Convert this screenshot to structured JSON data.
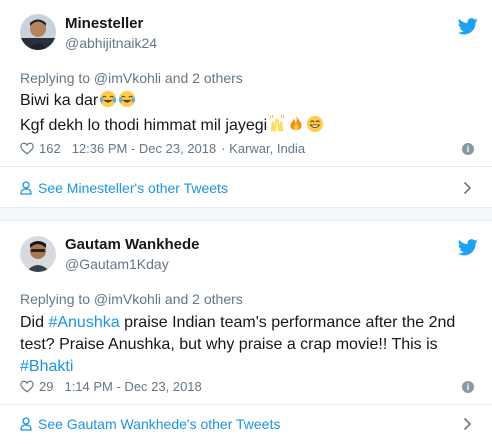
{
  "tweets": [
    {
      "name": "Minesteller",
      "handle": "@abhijitnaik24",
      "replying": "Replying to @imVkohli and 2 others",
      "line1": "Biwi ka dar",
      "line2": "Kgf dekh lo thodi himmat mil jayegi",
      "likes": "162",
      "time": "12:36 PM - Dec 23, 2018",
      "location": "· Karwar, India",
      "other_tweets": "See Minesteller's other Tweets"
    },
    {
      "name": "Gautam Wankhede",
      "handle": "@Gautam1Kday",
      "replying": "Replying to @imVkohli and 2 others",
      "text_a": "Did ",
      "hashtag1": "#Anushka",
      "text_b": " praise Indian team's performance after the 2nd test? Praise Anushka, but why praise a crap movie!! This is ",
      "hashtag2": "#Bhakti",
      "likes": "29",
      "time": "1:14 PM - Dec 23, 2018",
      "other_tweets": "See Gautam Wankhede's other Tweets"
    }
  ],
  "colors": {
    "link": "#1b95e0",
    "muted": "#657786",
    "twitter_blue": "#1da1f2"
  },
  "icons": [
    "twitter-bird-icon",
    "heart-icon",
    "info-icon",
    "person-icon",
    "chevron-right-icon",
    "joy-emoji",
    "raised-hands-emoji",
    "fire-emoji",
    "grin-emoji"
  ]
}
